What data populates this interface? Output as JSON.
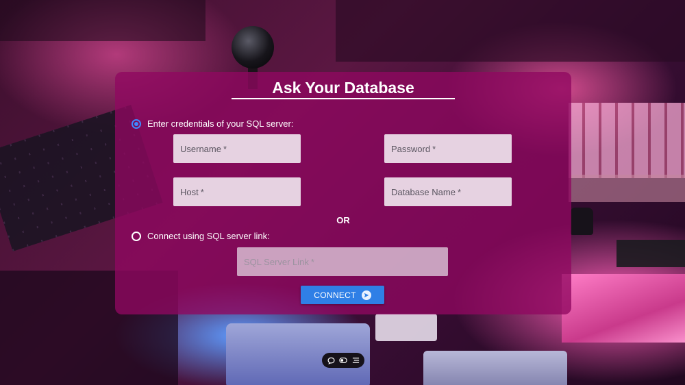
{
  "form": {
    "title": "Ask Your Database",
    "option_credentials_label": "Enter credentials of your SQL server:",
    "option_link_label": "Connect using SQL server link:",
    "selected_option": "credentials",
    "username": {
      "label": "Username",
      "required_mark": "*",
      "value": ""
    },
    "password": {
      "label": "Password",
      "required_mark": "*",
      "value": ""
    },
    "host": {
      "label": "Host",
      "required_mark": "*",
      "value": ""
    },
    "database_name": {
      "label": "Database Name",
      "required_mark": "*",
      "value": ""
    },
    "or_label": "OR",
    "server_link": {
      "label": "SQL Server Link",
      "required_mark": "*",
      "value": "",
      "disabled": true
    },
    "connect_label": "CONNECT",
    "connect_icon": "send-icon"
  },
  "toolbar": {
    "items": [
      {
        "icon": "chat-bubble-icon"
      },
      {
        "icon": "toggle-icon"
      },
      {
        "icon": "menu-lines-icon"
      }
    ]
  },
  "colors": {
    "card_background": "#900860",
    "accent_blue": "#2f7fe6",
    "radio_selected": "#3f88ff",
    "text_light": "#ffffff"
  }
}
